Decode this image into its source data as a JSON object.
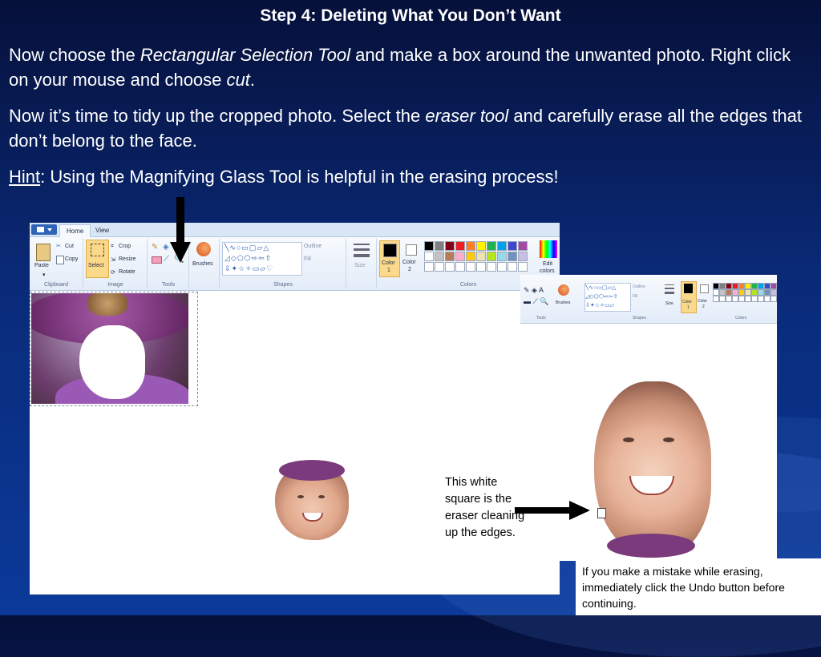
{
  "slide": {
    "title": "Step 4: Deleting What You Don’t Want",
    "para1": {
      "t1": "Now choose the ",
      "em1": "Rectangular Selection Tool",
      "t2": " and make a box around the unwanted photo. Right click on your mouse and choose ",
      "em2": "cut",
      "t3": "."
    },
    "para2": {
      "t1": "Now it’s time to tidy up the cropped photo. Select the ",
      "em1": "eraser tool",
      "t2": " and carefully erase all the edges that don’t belong to the face."
    },
    "hint": {
      "label": "Hint",
      "text": ": Using the Magnifying Glass Tool is helpful in the erasing process!"
    },
    "note_eraser": "This white square is the eraser cleaning up the edges.",
    "note_undo": "If you make a mistake while erasing, immediately click the Undo button before continuing."
  },
  "paint_main": {
    "tabs": [
      "Home",
      "View"
    ],
    "clipboard": {
      "paste": "Paste",
      "cut": "Cut",
      "copy": "Copy",
      "label": "Clipboard"
    },
    "image": {
      "select": "Select",
      "crop": "Crop",
      "resize": "Resize",
      "rotate": "Rotate",
      "label": "Image"
    },
    "tools": {
      "label": "Tools"
    },
    "brushes": "Brushes",
    "shapes": {
      "outline": "Outline",
      "fill": "Fill",
      "label": "Shapes"
    },
    "size": "Size",
    "color1": {
      "line1": "Color",
      "line2": "1"
    },
    "color2": {
      "line1": "Color",
      "line2": "2"
    },
    "colors_label": "Colors",
    "edit_colors": {
      "line1": "Edit",
      "line2": "colors"
    }
  },
  "paint_zoom": {
    "brushes": "Brushes",
    "shapes": {
      "outline": "Outline",
      "fill": "Fill",
      "label": "Shapes"
    },
    "size": "Size",
    "color1": {
      "line1": "Color",
      "line2": "1"
    },
    "color2": {
      "line1": "Color",
      "line2": "2"
    },
    "tools_label": "Tools",
    "colors_label": "Colors"
  },
  "palette_row1": [
    "#000000",
    "#7f7f7f",
    "#880015",
    "#ed1c24",
    "#ff7f27",
    "#fff200",
    "#22b14c",
    "#00a2e8",
    "#3f48cc",
    "#a349a4"
  ],
  "palette_row2": [
    "#ffffff",
    "#c3c3c3",
    "#b97a57",
    "#ffaec9",
    "#ffc90e",
    "#efe4b0",
    "#b5e61d",
    "#99d9ea",
    "#7092be",
    "#c8bfe7"
  ]
}
